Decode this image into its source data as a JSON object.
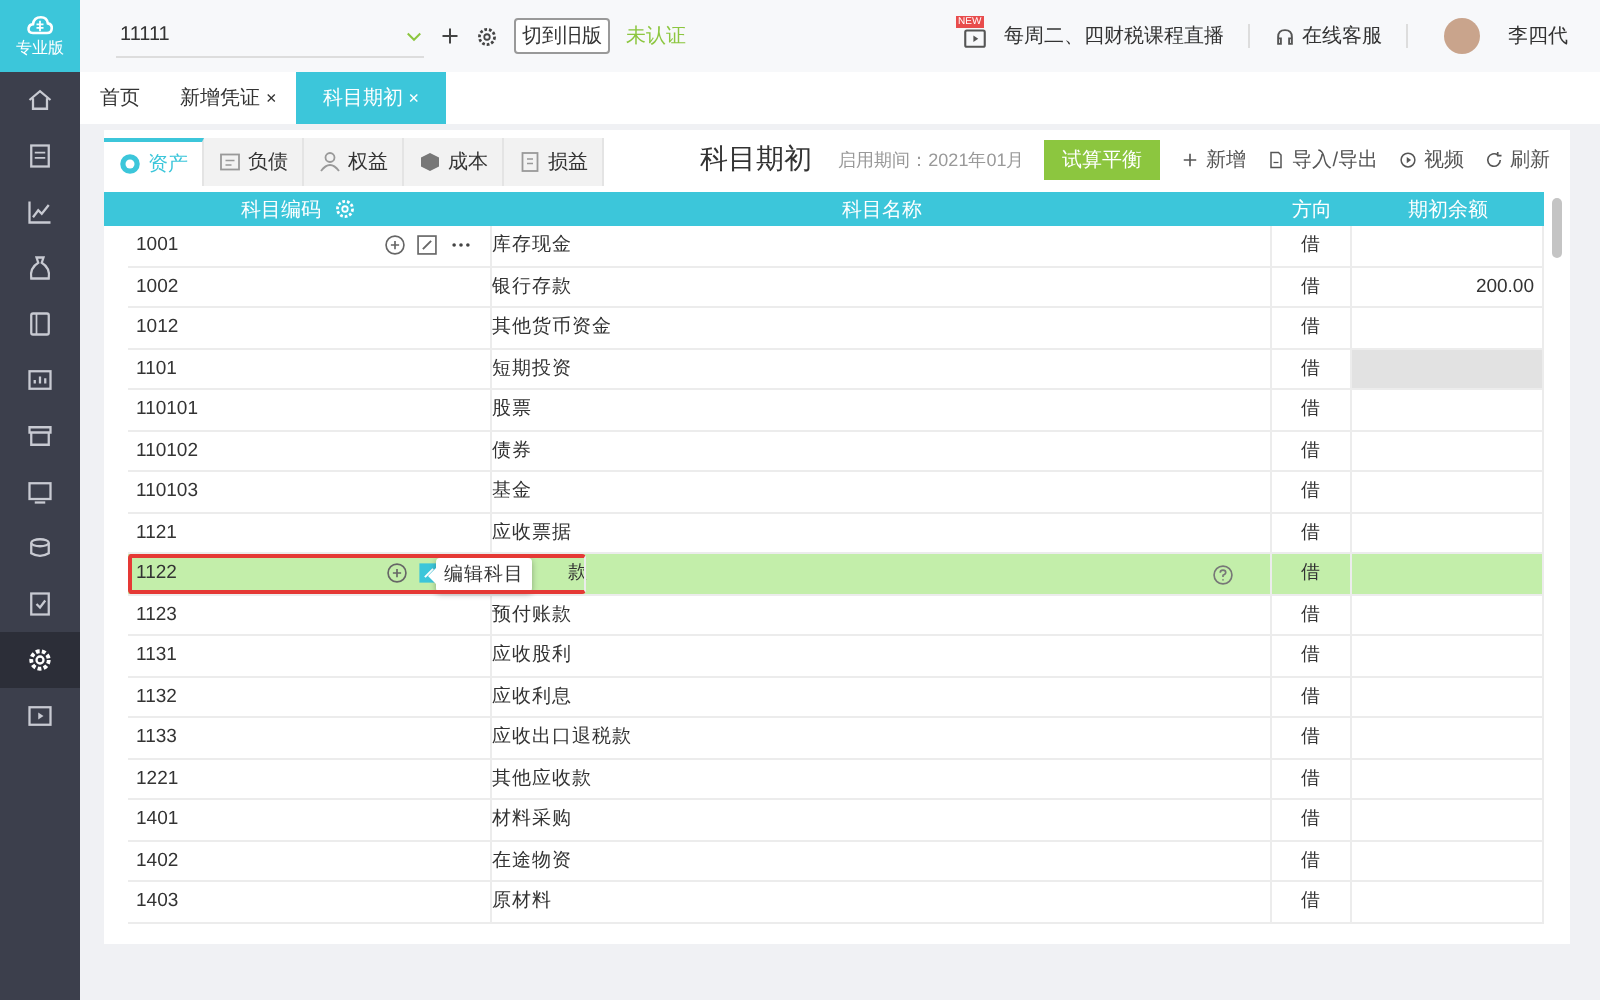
{
  "logo": {
    "caption": "专业版"
  },
  "sidebar": {
    "items": [
      {
        "selected": false
      },
      {
        "selected": false
      },
      {
        "selected": false
      },
      {
        "selected": false
      },
      {
        "selected": false
      },
      {
        "selected": false
      },
      {
        "selected": false
      },
      {
        "selected": false
      },
      {
        "selected": false
      },
      {
        "selected": false
      },
      {
        "selected": true
      },
      {
        "selected": false
      }
    ]
  },
  "topbar": {
    "account": "11111",
    "switch_button": "切到旧版",
    "auth_status": "未认证",
    "badge": "NEW",
    "live": "每周二、四财税课程直播",
    "service": "在线客服",
    "user": "李四代"
  },
  "tabs": [
    {
      "label": "首页",
      "selected": false
    },
    {
      "label": "新增凭证",
      "close": "×",
      "selected": false
    },
    {
      "label": "科目期初",
      "close": "×",
      "selected": true
    }
  ],
  "categories": [
    {
      "label": "资产",
      "selected": true
    },
    {
      "label": "负债",
      "selected": false
    },
    {
      "label": "权益",
      "selected": false
    },
    {
      "label": "成本",
      "selected": false
    },
    {
      "label": "损益",
      "selected": false
    }
  ],
  "title": "科目期初",
  "period": "启用期间：2021年01月",
  "balance_button": "试算平衡",
  "actions": [
    {
      "kind": "add",
      "label": "新增"
    },
    {
      "kind": "import",
      "label": "导入/导出"
    },
    {
      "kind": "video",
      "label": "视频"
    },
    {
      "kind": "refresh",
      "label": "刷新"
    }
  ],
  "table": {
    "columns": [
      "科目编码",
      "科目名称",
      "方向",
      "期初余额"
    ],
    "rows": [
      {
        "code": "1001",
        "name": "库存现金",
        "direction": "借",
        "selected": false,
        "show_actions": true,
        "balance_disabled": false,
        "outlined": false
      },
      {
        "code": "1002",
        "name": "银行存款",
        "direction": "借",
        "balance": "200.00",
        "selected": false,
        "show_actions": false,
        "balance_disabled": false,
        "outlined": false
      },
      {
        "code": "1012",
        "name": "其他货币资金",
        "direction": "借",
        "selected": false,
        "show_actions": false,
        "balance_disabled": false,
        "outlined": false
      },
      {
        "code": "1101",
        "name": "短期投资",
        "direction": "借",
        "selected": false,
        "show_actions": false,
        "balance_disabled": true,
        "outlined": false
      },
      {
        "code": "110101",
        "name": "股票",
        "direction": "借",
        "selected": false,
        "show_actions": false,
        "balance_disabled": false,
        "outlined": false
      },
      {
        "code": "110102",
        "name": "债券",
        "direction": "借",
        "selected": false,
        "show_actions": false,
        "balance_disabled": false,
        "outlined": false
      },
      {
        "code": "110103",
        "name": "基金",
        "direction": "借",
        "selected": false,
        "show_actions": false,
        "balance_disabled": false,
        "outlined": false
      },
      {
        "code": "1121",
        "name": "应收票据",
        "direction": "借",
        "selected": false,
        "show_actions": false,
        "balance_disabled": false,
        "outlined": false
      },
      {
        "code": "1122",
        "name": "款",
        "direction": "借",
        "selected": true,
        "show_actions": true,
        "tooltip": "编辑科目",
        "help_icon": true,
        "balance_disabled": false,
        "outlined": true
      },
      {
        "code": "1123",
        "name": "预付账款",
        "direction": "借",
        "selected": false,
        "show_actions": false,
        "balance_disabled": false,
        "outlined": false
      },
      {
        "code": "1131",
        "name": "应收股利",
        "direction": "借",
        "selected": false,
        "show_actions": false,
        "balance_disabled": false,
        "outlined": false
      },
      {
        "code": "1132",
        "name": "应收利息",
        "direction": "借",
        "selected": false,
        "show_actions": false,
        "balance_disabled": false,
        "outlined": false
      },
      {
        "code": "1133",
        "name": "应收出口退税款",
        "direction": "借",
        "selected": false,
        "show_actions": false,
        "balance_disabled": false,
        "outlined": false
      },
      {
        "code": "1221",
        "name": "其他应收款",
        "direction": "借",
        "selected": false,
        "show_actions": false,
        "balance_disabled": false,
        "outlined": false
      },
      {
        "code": "1401",
        "name": "材料采购",
        "direction": "借",
        "selected": false,
        "show_actions": false,
        "balance_disabled": false,
        "outlined": false
      },
      {
        "code": "1402",
        "name": "在途物资",
        "direction": "借",
        "selected": false,
        "show_actions": false,
        "balance_disabled": false,
        "outlined": false
      },
      {
        "code": "1403",
        "name": "原材料",
        "direction": "借",
        "selected": false,
        "show_actions": false,
        "balance_disabled": false,
        "outlined": false
      }
    ]
  }
}
